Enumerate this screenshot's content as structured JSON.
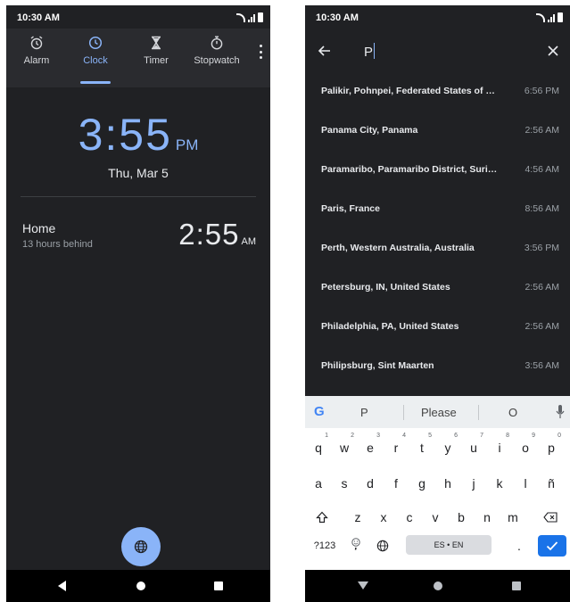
{
  "left_screen": {
    "status_time": "10:30 AM",
    "tabs": [
      {
        "label": "Alarm",
        "icon": "alarm-icon"
      },
      {
        "label": "Clock",
        "icon": "clock-icon",
        "active": true
      },
      {
        "label": "Timer",
        "icon": "hourglass-icon"
      },
      {
        "label": "Stopwatch",
        "icon": "stopwatch-icon"
      }
    ],
    "main_time": "3:55",
    "main_ampm": "PM",
    "date": "Thu, Mar 5",
    "home": {
      "city": "Home",
      "subtitle": "13 hours behind",
      "time": "2:55",
      "ampm": "AM"
    },
    "fab_icon": "globe-icon"
  },
  "right_screen": {
    "status_time": "10:30 AM",
    "search_value": "P",
    "results": [
      {
        "city": "Palikir, Pohnpei, Federated States of Micronesia",
        "time": "6:56 PM"
      },
      {
        "city": "Panama City, Panama",
        "time": "2:56 AM"
      },
      {
        "city": "Paramaribo, Paramaribo District, Suriname",
        "time": "4:56 AM"
      },
      {
        "city": "Paris, France",
        "time": "8:56 AM"
      },
      {
        "city": "Perth, Western Australia, Australia",
        "time": "3:56 PM"
      },
      {
        "city": "Petersburg, IN, United States",
        "time": "2:56 AM"
      },
      {
        "city": "Philadelphia, PA, United States",
        "time": "2:56 AM"
      },
      {
        "city": "Philipsburg, Sint Maarten",
        "time": "3:56 AM"
      }
    ],
    "keyboard": {
      "suggestions": [
        "P",
        "Please",
        "O"
      ],
      "row1": [
        "q",
        "w",
        "e",
        "r",
        "t",
        "y",
        "u",
        "i",
        "o",
        "p"
      ],
      "row1_hints": [
        "1",
        "2",
        "3",
        "4",
        "5",
        "6",
        "7",
        "8",
        "9",
        "0"
      ],
      "row2": [
        "a",
        "s",
        "d",
        "f",
        "g",
        "h",
        "j",
        "k",
        "l",
        "ñ"
      ],
      "row3": [
        "z",
        "x",
        "c",
        "v",
        "b",
        "n",
        "m"
      ],
      "symbols_label": "?123",
      "space_label": "ES • EN",
      "period_label": "."
    }
  },
  "colors": {
    "accent": "#8ab4f8",
    "background": "#202124",
    "enter_key": "#1a73e8"
  }
}
